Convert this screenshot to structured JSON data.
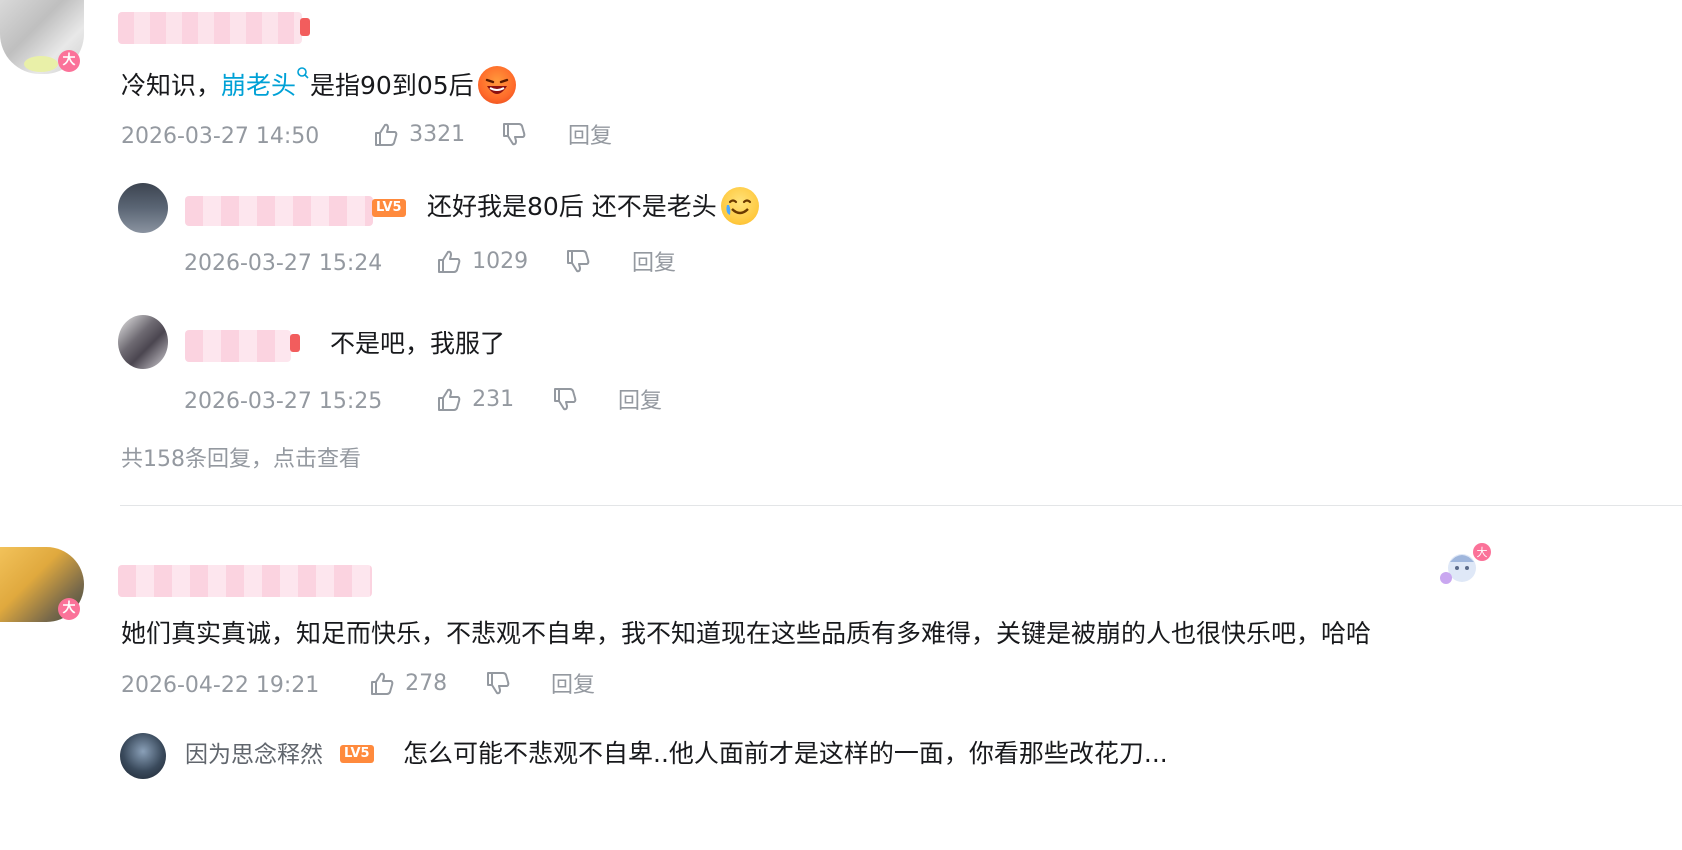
{
  "comments": [
    {
      "text_prefix": "冷知识，",
      "link": "崩老头",
      "text_suffix": "是指90到05后",
      "date": "2026-03-27 14:50",
      "likes": "3321",
      "reply_label": "回复",
      "replies": [
        {
          "text": "还好我是80后 还不是老头",
          "date": "2026-03-27 15:24",
          "likes": "1029",
          "reply_label": "回复"
        },
        {
          "text": "不是吧，我服了",
          "date": "2026-03-27 15:25",
          "likes": "231",
          "reply_label": "回复"
        }
      ],
      "more_replies": "共158条回复，点击查看"
    },
    {
      "text": "她们真实真诚，知足而快乐，不悲观不自卑，我不知道现在这些品质有多难得，关键是被崩的人也很快乐吧，哈哈",
      "date": "2026-04-22 19:21",
      "likes": "278",
      "reply_label": "回复",
      "replies": [
        {
          "username": "因为思念释然",
          "level": "LV5",
          "text": "怎么可能不悲观不自卑..他人面前才是这样的一面，你看那些改花刀..."
        }
      ]
    }
  ],
  "badges": {
    "da": "大",
    "lv": "LV5"
  },
  "colors": {
    "link": "#00a1d6",
    "meta": "#9499a0",
    "pink": "#fb7299",
    "lv5": "#ff8a3d"
  },
  "icons": [
    "search-icon",
    "thumbs-up-icon",
    "thumbs-down-icon",
    "laughing-emoji-icon",
    "cry-laugh-emoji-icon"
  ]
}
